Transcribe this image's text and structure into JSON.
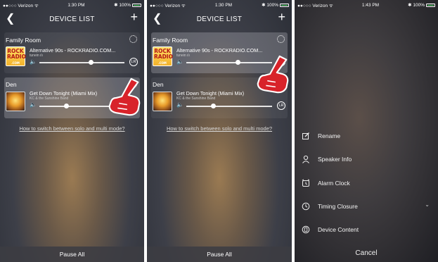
{
  "colors": {
    "accent_red": "#d8232a",
    "battery": "#4cd964"
  },
  "panels": [
    {
      "status": {
        "carrier": "●●○○○ Verizon ᯤ",
        "time": "1:30 PM",
        "battery": "✱ 100%"
      },
      "title": "DEVICE LIST",
      "devices": [
        {
          "room": "Family Room",
          "track": "Alternative 90s - ROCKRADIO.COM...",
          "sub": "tunein ılı",
          "volume": 0.72,
          "art": [
            "ROCK",
            "RADIO",
            ".COM"
          ]
        },
        {
          "room": "Den",
          "track": "Get Down Tonight (Miami Mix)",
          "sub": "KC & the Sunshine Band",
          "volume": 0.42
        }
      ],
      "lr_label": "LR",
      "switch_link": "How to switch between solo and multi mode?",
      "pause_all": "Pause All"
    },
    {
      "status": {
        "carrier": "●●○○○ Verizon ᯤ",
        "time": "1:30 PM",
        "battery": "✱ 100%"
      },
      "title": "DEVICE LIST",
      "devices": [
        {
          "room": "Family Room",
          "track": "Alternative 90s - ROCKRADIO.COM...",
          "sub": "tunein ılı",
          "volume": 0.72,
          "art": [
            "ROCK",
            "RADIO",
            ".COM"
          ]
        },
        {
          "room": "Den",
          "track": "Get Down Tonight (Miami Mix)",
          "sub": "KC & the Sunshine Band",
          "volume": 0.42
        }
      ],
      "lr_label": "LR",
      "switch_link": "How to switch between solo and multi mode?",
      "pause_all": "Pause All"
    },
    {
      "status": {
        "carrier": "●●○○○ Verizon ᯤ",
        "time": "1:43 PM",
        "battery": "✱ 100%"
      },
      "menu": [
        {
          "label": "Rename",
          "icon": "edit-icon"
        },
        {
          "label": "Speaker Info",
          "icon": "person-icon"
        },
        {
          "label": "Alarm Clock",
          "icon": "alarm-clock-icon"
        },
        {
          "label": "Timing Closure",
          "icon": "timer-icon",
          "chevron": "⌄"
        },
        {
          "label": "Device Content",
          "icon": "device-content-icon"
        }
      ],
      "cancel": "Cancel"
    }
  ]
}
